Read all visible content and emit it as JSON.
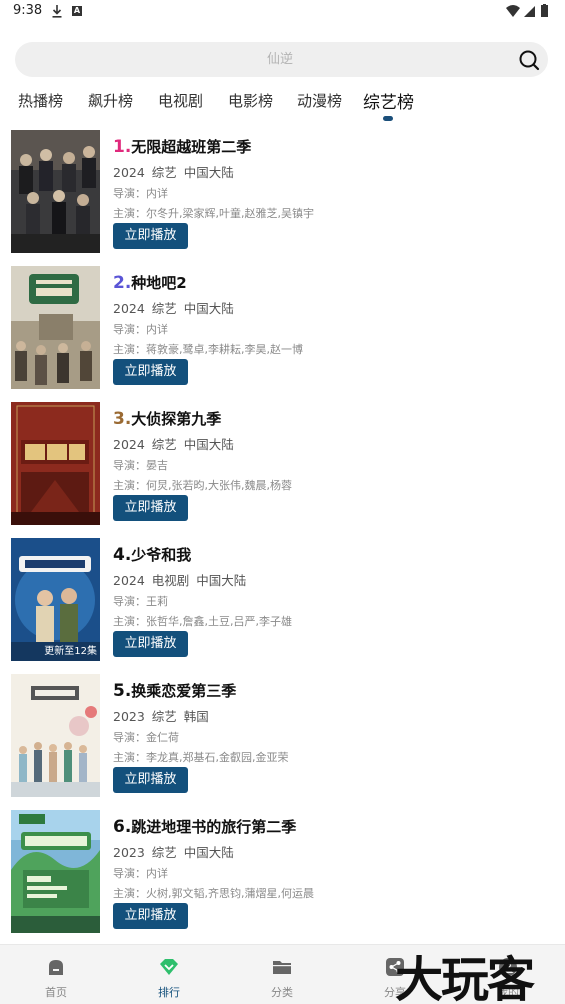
{
  "status_bar": {
    "time": "9:38",
    "icons": [
      "download-icon",
      "a-icon",
      "wifi-icon",
      "signal-icon",
      "battery-icon"
    ]
  },
  "search": {
    "placeholder": "仙逆",
    "icon": "search-icon"
  },
  "tabs": [
    {
      "label": "热播榜"
    },
    {
      "label": "飙升榜"
    },
    {
      "label": "电视剧"
    },
    {
      "label": "电影榜"
    },
    {
      "label": "动漫榜"
    },
    {
      "label": "综艺榜",
      "active": true
    }
  ],
  "items": [
    {
      "rank": "1.",
      "title": "无限超越班第二季",
      "year": "2024",
      "genre": "综艺",
      "region": "中国大陆",
      "director": "导演：内详",
      "actors": "主演：尔冬升,梁家辉,叶童,赵雅芝,吴镇宇",
      "button": "立即播放",
      "rank_color": "#e0297c"
    },
    {
      "rank": "2.",
      "title": "种地吧2",
      "year": "2024",
      "genre": "综艺",
      "region": "中国大陆",
      "director": "导演：内详",
      "actors": "主演：蒋敦豪,鹭卓,李耕耘,李昊,赵一博",
      "button": "立即播放",
      "rank_color": "#5a55d6"
    },
    {
      "rank": "3.",
      "title": "大侦探第九季",
      "year": "2024",
      "genre": "综艺",
      "region": "中国大陆",
      "director": "导演：晏吉",
      "actors": "主演：何炅,张若昀,大张伟,魏晨,杨蓉",
      "button": "立即播放",
      "rank_color": "#9a6a33"
    },
    {
      "rank": "4.",
      "title": "少爷和我",
      "year": "2024",
      "genre": "电视剧",
      "region": "中国大陆",
      "director": "导演：王莉",
      "actors": "主演：张哲华,詹鑫,土豆,吕严,李子雄",
      "button": "立即播放",
      "rank_color": "#111111",
      "badge": "更新至12集"
    },
    {
      "rank": "5.",
      "title": "换乘恋爱第三季",
      "year": "2023",
      "genre": "综艺",
      "region": "韩国",
      "director": "导演：金仁荷",
      "actors": "主演：李龙真,郑基石,金叡园,金亚荣",
      "button": "立即播放",
      "rank_color": "#111111"
    },
    {
      "rank": "6.",
      "title": "跳进地理书的旅行第二季",
      "year": "2023",
      "genre": "综艺",
      "region": "中国大陆",
      "director": "导演：内详",
      "actors": "主演：火树,郭文韬,齐思钧,蒲熠星,何运晨",
      "button": "立即播放",
      "rank_color": "#111111"
    }
  ],
  "bottom_nav": [
    {
      "label": "首页",
      "icon": "home-icon"
    },
    {
      "label": "排行",
      "icon": "rank-icon",
      "active": true
    },
    {
      "label": "分类",
      "icon": "folder-icon"
    },
    {
      "label": "分享",
      "icon": "share-icon"
    },
    {
      "label": "我的",
      "icon": "user-icon"
    }
  ],
  "watermark": "大玩客",
  "colors": {
    "accent": "#13507c",
    "rank1": "#e0297c",
    "rank2": "#5a55d6",
    "rank3": "#9a6a33",
    "nav_active": "#13507c"
  }
}
